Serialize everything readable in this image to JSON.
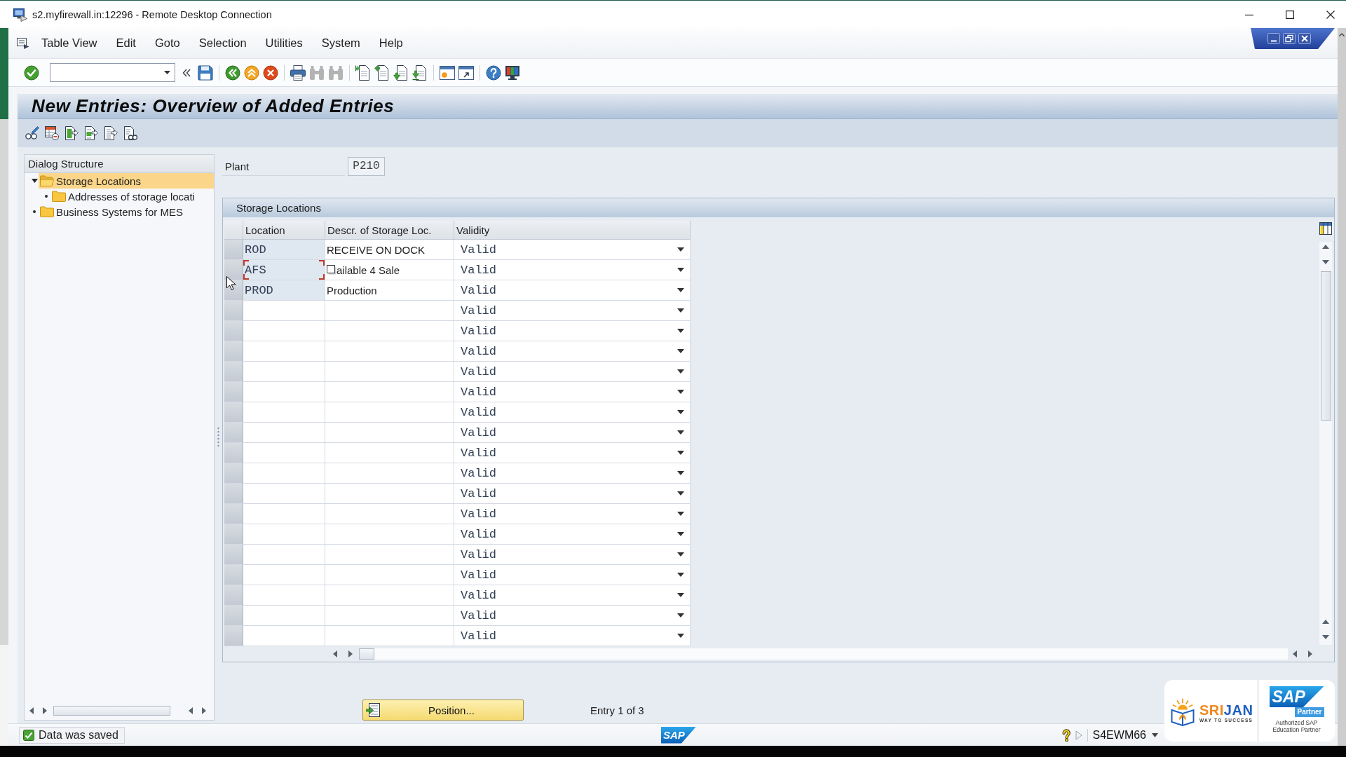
{
  "window": {
    "title": "s2.myfirewall.in:12296 - Remote Desktop Connection"
  },
  "menu": [
    "Table View",
    "Edit",
    "Goto",
    "Selection",
    "Utilities",
    "System",
    "Help"
  ],
  "toolbar": {
    "leading": [
      {
        "kind": "enter",
        "disabled": false
      }
    ],
    "groups": [
      [
        {
          "kind": "save",
          "disabled": false
        }
      ],
      [
        {
          "kind": "back",
          "disabled": false
        },
        {
          "kind": "exit",
          "disabled": false
        },
        {
          "kind": "cancel",
          "disabled": false
        }
      ],
      [
        {
          "kind": "print",
          "disabled": false
        },
        {
          "kind": "find",
          "disabled": true
        },
        {
          "kind": "find_next",
          "disabled": true
        }
      ],
      [
        {
          "kind": "first_page",
          "disabled": false
        },
        {
          "kind": "previous_page",
          "disabled": false
        },
        {
          "kind": "next_page",
          "disabled": false
        },
        {
          "kind": "last_page",
          "disabled": false
        }
      ],
      [
        {
          "kind": "new_session",
          "disabled": false
        },
        {
          "kind": "shortcut",
          "disabled": false
        }
      ],
      [
        {
          "kind": "help",
          "disabled": false
        },
        {
          "kind": "layout",
          "disabled": false
        }
      ]
    ]
  },
  "screen_title": "New Entries: Overview of Added Entries",
  "dialog_structure": {
    "title": "Dialog Structure",
    "items": [
      {
        "label": "Storage Locations",
        "expanded": true,
        "selected": true,
        "children": [
          {
            "label": "Addresses of storage locati",
            "selected": false
          }
        ]
      },
      {
        "label": "Business Systems for MES",
        "selected": false
      }
    ]
  },
  "plant": {
    "label": "Plant",
    "value": "P210"
  },
  "table": {
    "title": "Storage Locations",
    "columns": [
      "Location",
      "Descr. of Storage Loc.",
      "Validity"
    ],
    "rows": [
      {
        "location": "ROD",
        "description": "RECEIVE ON DOCK",
        "validity": "Valid",
        "locked": true,
        "focused": false,
        "marked": false,
        "selected": false
      },
      {
        "location": "AFS",
        "description": "ailable 4 Sale",
        "validity": "Valid",
        "locked": true,
        "focused": true,
        "marked": true,
        "selected": false
      },
      {
        "location": "PROD",
        "description": "Production",
        "validity": "Valid",
        "locked": true,
        "focused": false,
        "marked": false,
        "selected": false
      },
      {
        "validity": "Valid",
        "locked": false,
        "focused": false,
        "marked": false,
        "selected": false
      },
      {
        "validity": "Valid",
        "locked": false,
        "focused": false,
        "marked": false,
        "selected": false
      },
      {
        "validity": "Valid",
        "locked": false,
        "focused": false,
        "marked": false,
        "selected": false
      },
      {
        "validity": "Valid",
        "locked": false,
        "focused": false,
        "marked": false,
        "selected": false
      },
      {
        "validity": "Valid",
        "locked": false,
        "focused": false,
        "marked": false,
        "selected": false
      },
      {
        "validity": "Valid",
        "locked": false,
        "focused": false,
        "marked": false,
        "selected": false
      },
      {
        "validity": "Valid",
        "locked": false,
        "focused": false,
        "marked": false,
        "selected": false
      },
      {
        "validity": "Valid",
        "locked": false,
        "focused": false,
        "marked": false,
        "selected": false
      },
      {
        "validity": "Valid",
        "locked": false,
        "focused": false,
        "marked": false,
        "selected": false
      },
      {
        "validity": "Valid",
        "locked": false,
        "focused": false,
        "marked": false,
        "selected": false
      },
      {
        "validity": "Valid",
        "locked": false,
        "focused": false,
        "marked": false,
        "selected": false
      },
      {
        "validity": "Valid",
        "locked": false,
        "focused": false,
        "marked": false,
        "selected": false
      },
      {
        "validity": "Valid",
        "locked": false,
        "focused": false,
        "marked": false,
        "selected": false
      },
      {
        "validity": "Valid",
        "locked": false,
        "focused": false,
        "marked": false,
        "selected": false
      },
      {
        "validity": "Valid",
        "locked": false,
        "focused": false,
        "marked": false,
        "selected": false
      },
      {
        "validity": "Valid",
        "locked": false,
        "focused": false,
        "marked": false,
        "selected": false
      },
      {
        "validity": "Valid",
        "locked": false,
        "focused": false,
        "marked": false,
        "selected": false
      }
    ]
  },
  "position_button": {
    "label": "Position..."
  },
  "entry_info": "Entry 1 of 3",
  "status_bar": {
    "message": "Data was saved",
    "logo": "SAP",
    "system": "S4EWM66"
  },
  "branding": {
    "wordmark": [
      "SRI",
      "JAN"
    ],
    "tagline": "WAY TO SUCCESS",
    "partner_logo": "SAP",
    "partner_badge": "Partner",
    "partner_caption": [
      "Authorized SAP",
      "Education Partner"
    ]
  }
}
